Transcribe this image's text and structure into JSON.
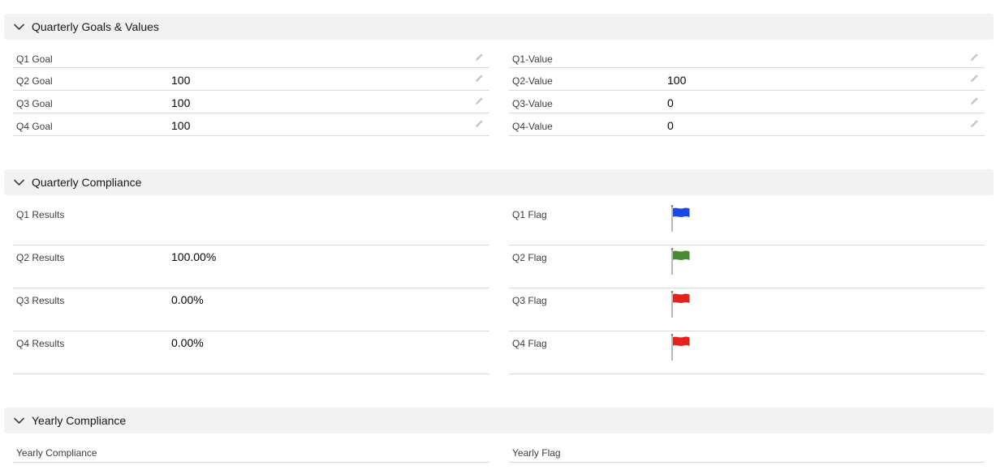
{
  "sections": {
    "goals": {
      "title": "Quarterly Goals & Values",
      "left": [
        {
          "label": "Q1 Goal",
          "value": ""
        },
        {
          "label": "Q2 Goal",
          "value": "100"
        },
        {
          "label": "Q3 Goal",
          "value": "100"
        },
        {
          "label": "Q4 Goal",
          "value": "100"
        }
      ],
      "right": [
        {
          "label": "Q1-Value",
          "value": ""
        },
        {
          "label": "Q2-Value",
          "value": "100"
        },
        {
          "label": "Q3-Value",
          "value": "0"
        },
        {
          "label": "Q4-Value",
          "value": "0"
        }
      ]
    },
    "compliance": {
      "title": "Quarterly Compliance",
      "left": [
        {
          "label": "Q1 Results",
          "value": ""
        },
        {
          "label": "Q2 Results",
          "value": "100.00%"
        },
        {
          "label": "Q3 Results",
          "value": "0.00%"
        },
        {
          "label": "Q4 Results",
          "value": "0.00%"
        }
      ],
      "right": [
        {
          "label": "Q1 Flag",
          "flag_color": "#1a47e8",
          "icon": "blue-flag-icon"
        },
        {
          "label": "Q2 Flag",
          "flag_color": "#4b8a34",
          "icon": "green-flag-icon"
        },
        {
          "label": "Q3 Flag",
          "flag_color": "#e5231b",
          "icon": "red-flag-icon"
        },
        {
          "label": "Q4 Flag",
          "flag_color": "#e5231b",
          "icon": "red-flag-icon"
        }
      ]
    },
    "yearly": {
      "title": "Yearly Compliance",
      "left": [
        {
          "label": "Yearly Compliance",
          "value": ""
        }
      ],
      "right": [
        {
          "label": "Yearly Flag",
          "value": ""
        }
      ]
    }
  },
  "icons": {
    "section_toggle": "chevron-down-icon",
    "edit": "pencil-icon"
  }
}
